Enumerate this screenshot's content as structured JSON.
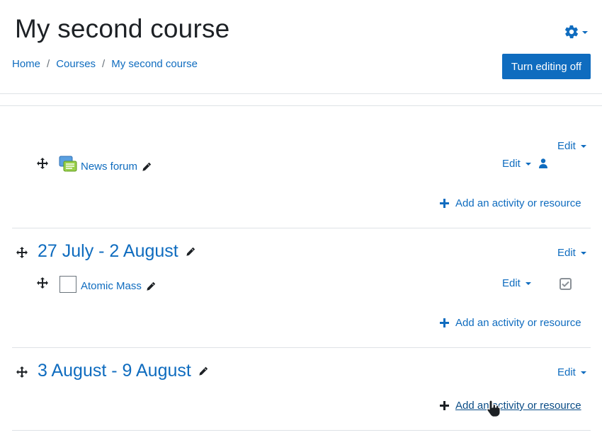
{
  "header": {
    "title": "My second course",
    "settings_icon": "gear-icon",
    "edit_toggle_label": "Turn editing off"
  },
  "breadcrumb": {
    "items": [
      "Home",
      "Courses",
      "My second course"
    ],
    "separator": "/"
  },
  "sections": [
    {
      "title": "",
      "edit_label": "Edit",
      "activities": [
        {
          "name": "News forum",
          "icon": "forum-icon",
          "edit_label": "Edit",
          "extra_icon": "user-icon"
        }
      ],
      "add_label": "Add an activity or resource"
    },
    {
      "title": "27 July - 2 August",
      "edit_label": "Edit",
      "activities": [
        {
          "name": "Atomic Mass",
          "icon": "blank-activity-icon",
          "edit_label": "Edit",
          "extra_icon": "completion-checkbox-icon"
        }
      ],
      "add_label": "Add an activity or resource"
    },
    {
      "title": "3 August - 9 August",
      "edit_label": "Edit",
      "activities": [],
      "add_label": "Add an activity or resource"
    }
  ],
  "colors": {
    "accent": "#0f6cbf",
    "text": "#1d2125",
    "divider": "#dee2e6"
  }
}
